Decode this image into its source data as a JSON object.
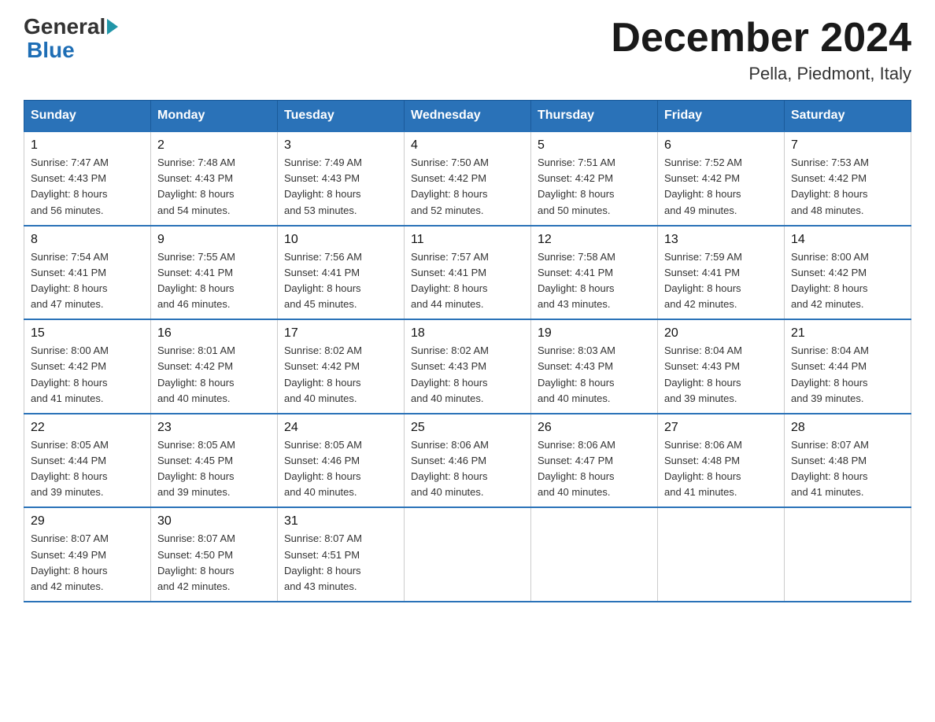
{
  "logo": {
    "general": "General",
    "blue": "Blue"
  },
  "header": {
    "month": "December 2024",
    "location": "Pella, Piedmont, Italy"
  },
  "days_of_week": [
    "Sunday",
    "Monday",
    "Tuesday",
    "Wednesday",
    "Thursday",
    "Friday",
    "Saturday"
  ],
  "weeks": [
    [
      {
        "day": "1",
        "sunrise": "7:47 AM",
        "sunset": "4:43 PM",
        "daylight": "8 hours and 56 minutes."
      },
      {
        "day": "2",
        "sunrise": "7:48 AM",
        "sunset": "4:43 PM",
        "daylight": "8 hours and 54 minutes."
      },
      {
        "day": "3",
        "sunrise": "7:49 AM",
        "sunset": "4:43 PM",
        "daylight": "8 hours and 53 minutes."
      },
      {
        "day": "4",
        "sunrise": "7:50 AM",
        "sunset": "4:42 PM",
        "daylight": "8 hours and 52 minutes."
      },
      {
        "day": "5",
        "sunrise": "7:51 AM",
        "sunset": "4:42 PM",
        "daylight": "8 hours and 50 minutes."
      },
      {
        "day": "6",
        "sunrise": "7:52 AM",
        "sunset": "4:42 PM",
        "daylight": "8 hours and 49 minutes."
      },
      {
        "day": "7",
        "sunrise": "7:53 AM",
        "sunset": "4:42 PM",
        "daylight": "8 hours and 48 minutes."
      }
    ],
    [
      {
        "day": "8",
        "sunrise": "7:54 AM",
        "sunset": "4:41 PM",
        "daylight": "8 hours and 47 minutes."
      },
      {
        "day": "9",
        "sunrise": "7:55 AM",
        "sunset": "4:41 PM",
        "daylight": "8 hours and 46 minutes."
      },
      {
        "day": "10",
        "sunrise": "7:56 AM",
        "sunset": "4:41 PM",
        "daylight": "8 hours and 45 minutes."
      },
      {
        "day": "11",
        "sunrise": "7:57 AM",
        "sunset": "4:41 PM",
        "daylight": "8 hours and 44 minutes."
      },
      {
        "day": "12",
        "sunrise": "7:58 AM",
        "sunset": "4:41 PM",
        "daylight": "8 hours and 43 minutes."
      },
      {
        "day": "13",
        "sunrise": "7:59 AM",
        "sunset": "4:41 PM",
        "daylight": "8 hours and 42 minutes."
      },
      {
        "day": "14",
        "sunrise": "8:00 AM",
        "sunset": "4:42 PM",
        "daylight": "8 hours and 42 minutes."
      }
    ],
    [
      {
        "day": "15",
        "sunrise": "8:00 AM",
        "sunset": "4:42 PM",
        "daylight": "8 hours and 41 minutes."
      },
      {
        "day": "16",
        "sunrise": "8:01 AM",
        "sunset": "4:42 PM",
        "daylight": "8 hours and 40 minutes."
      },
      {
        "day": "17",
        "sunrise": "8:02 AM",
        "sunset": "4:42 PM",
        "daylight": "8 hours and 40 minutes."
      },
      {
        "day": "18",
        "sunrise": "8:02 AM",
        "sunset": "4:43 PM",
        "daylight": "8 hours and 40 minutes."
      },
      {
        "day": "19",
        "sunrise": "8:03 AM",
        "sunset": "4:43 PM",
        "daylight": "8 hours and 40 minutes."
      },
      {
        "day": "20",
        "sunrise": "8:04 AM",
        "sunset": "4:43 PM",
        "daylight": "8 hours and 39 minutes."
      },
      {
        "day": "21",
        "sunrise": "8:04 AM",
        "sunset": "4:44 PM",
        "daylight": "8 hours and 39 minutes."
      }
    ],
    [
      {
        "day": "22",
        "sunrise": "8:05 AM",
        "sunset": "4:44 PM",
        "daylight": "8 hours and 39 minutes."
      },
      {
        "day": "23",
        "sunrise": "8:05 AM",
        "sunset": "4:45 PM",
        "daylight": "8 hours and 39 minutes."
      },
      {
        "day": "24",
        "sunrise": "8:05 AM",
        "sunset": "4:46 PM",
        "daylight": "8 hours and 40 minutes."
      },
      {
        "day": "25",
        "sunrise": "8:06 AM",
        "sunset": "4:46 PM",
        "daylight": "8 hours and 40 minutes."
      },
      {
        "day": "26",
        "sunrise": "8:06 AM",
        "sunset": "4:47 PM",
        "daylight": "8 hours and 40 minutes."
      },
      {
        "day": "27",
        "sunrise": "8:06 AM",
        "sunset": "4:48 PM",
        "daylight": "8 hours and 41 minutes."
      },
      {
        "day": "28",
        "sunrise": "8:07 AM",
        "sunset": "4:48 PM",
        "daylight": "8 hours and 41 minutes."
      }
    ],
    [
      {
        "day": "29",
        "sunrise": "8:07 AM",
        "sunset": "4:49 PM",
        "daylight": "8 hours and 42 minutes."
      },
      {
        "day": "30",
        "sunrise": "8:07 AM",
        "sunset": "4:50 PM",
        "daylight": "8 hours and 42 minutes."
      },
      {
        "day": "31",
        "sunrise": "8:07 AM",
        "sunset": "4:51 PM",
        "daylight": "8 hours and 43 minutes."
      },
      null,
      null,
      null,
      null
    ]
  ],
  "labels": {
    "sunrise": "Sunrise: ",
    "sunset": "Sunset: ",
    "daylight": "Daylight: "
  }
}
